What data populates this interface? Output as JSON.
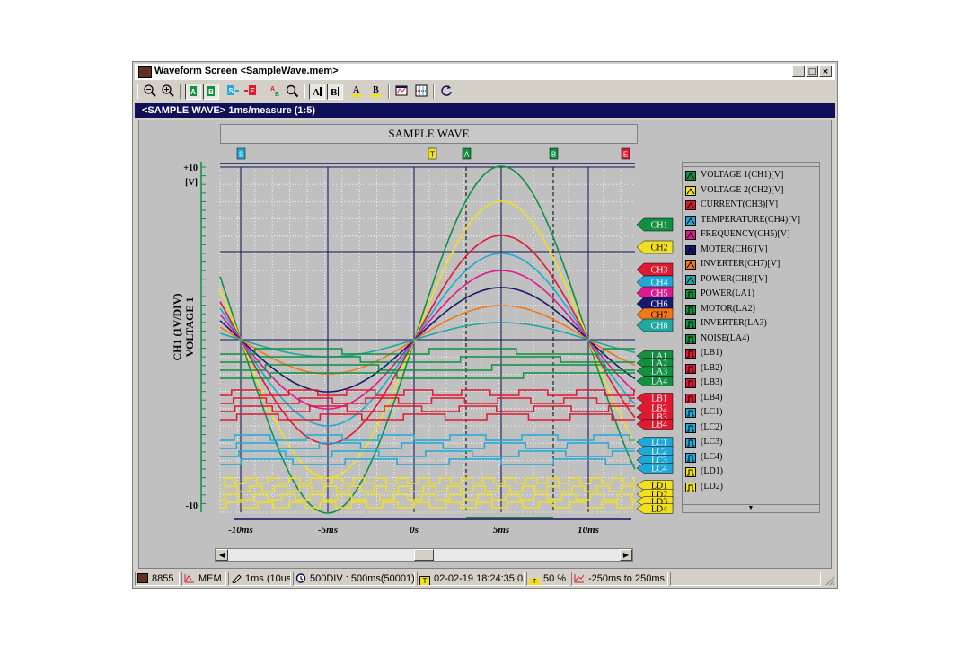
{
  "window": {
    "title": "Waveform Screen <SampleWave.mem>",
    "buttons": {
      "minimize": "_",
      "maximize": "□",
      "close": "×"
    }
  },
  "toolbar": {
    "icons": [
      "zoom-out-icon",
      "zoom-in-icon",
      "cursor-a-icon",
      "cursor-b-icon",
      "start-point-icon",
      "end-point-icon",
      "ab-icon",
      "find-icon",
      "a-cursor-icon",
      "b-cursor-icon",
      "a-underline-icon",
      "b-underline-icon",
      "print-icon",
      "grid-icon",
      "refresh-icon"
    ]
  },
  "subtitle": "<SAMPLE WAVE> 1ms/measure (1:5)",
  "wave_title": "SAMPLE WAVE",
  "markers": {
    "s": "S",
    "t": "T",
    "a": "A",
    "b": "B",
    "e": "E"
  },
  "y_axis": {
    "label_line1": "CH1 (1V/DIV)",
    "label_line2": "VOLTAGE 1",
    "top": "+10",
    "unit": "[V]",
    "bottom": "-10"
  },
  "x_axis": {
    "ticks": [
      "-10ms",
      "-5ms",
      "0s",
      "5ms",
      "10ms"
    ]
  },
  "tags": {
    "analog": [
      "CH1",
      "CH2",
      "CH3",
      "CH4",
      "CH5",
      "CH6",
      "CH7",
      "CH8"
    ],
    "logic": [
      "LA1",
      "LA2",
      "LA3",
      "LA4",
      "LB1",
      "LB2",
      "LB3",
      "LB4",
      "LC1",
      "LC2",
      "LC3",
      "LC4",
      "LD1",
      "LD2",
      "LD3",
      "LD4"
    ]
  },
  "colors": {
    "CH1": "#109040",
    "CH2": "#f0e020",
    "CH3": "#e01830",
    "CH4": "#20a8d8",
    "CH5": "#e01890",
    "CH6": "#181870",
    "CH7": "#f07818",
    "CH8": "#20a8a0",
    "LA": "#109040",
    "LB": "#e01830",
    "LC": "#20a8d8",
    "LD": "#f0e020"
  },
  "legend": [
    {
      "label": "VOLTAGE 1(CH1)[V]",
      "color": "#109040"
    },
    {
      "label": "VOLTAGE 2(CH2)[V]",
      "color": "#f0e020"
    },
    {
      "label": "CURRENT(CH3)[V]",
      "color": "#e01830"
    },
    {
      "label": "TEMPERATURE(CH4)[V]",
      "color": "#20a8d8"
    },
    {
      "label": "FREQUENCY(CH5)[V]",
      "color": "#e01890"
    },
    {
      "label": "MOTER(CH6)[V]",
      "color": "#181870"
    },
    {
      "label": "INVERTER(CH7)[V]",
      "color": "#f07818"
    },
    {
      "label": "POWER(CH8)[V]",
      "color": "#20a8a0"
    },
    {
      "label": "POWER(LA1)",
      "color": "#109040"
    },
    {
      "label": "MOTOR(LA2)",
      "color": "#109040"
    },
    {
      "label": "INVERTER(LA3)",
      "color": "#109040"
    },
    {
      "label": "NOISE(LA4)",
      "color": "#109040"
    },
    {
      "label": "(LB1)",
      "color": "#e01830"
    },
    {
      "label": "(LB2)",
      "color": "#e01830"
    },
    {
      "label": "(LB3)",
      "color": "#e01830"
    },
    {
      "label": "(LB4)",
      "color": "#e01830"
    },
    {
      "label": "(LC1)",
      "color": "#20a8d8"
    },
    {
      "label": "(LC2)",
      "color": "#20a8d8"
    },
    {
      "label": "(LC3)",
      "color": "#20a8d8"
    },
    {
      "label": "(LC4)",
      "color": "#20a8d8"
    },
    {
      "label": "(LD1)",
      "color": "#f0e020"
    },
    {
      "label": "(LD2)",
      "color": "#f0e020"
    }
  ],
  "status": {
    "model": "8855",
    "mode": "MEM",
    "timebase": "1ms (10us)",
    "div": "500DIV : 500ms(50001)",
    "trigger_time": "02-02-19 18:24:35:03",
    "pretrigger": "50 %",
    "range": "-250ms to 250ms"
  }
}
